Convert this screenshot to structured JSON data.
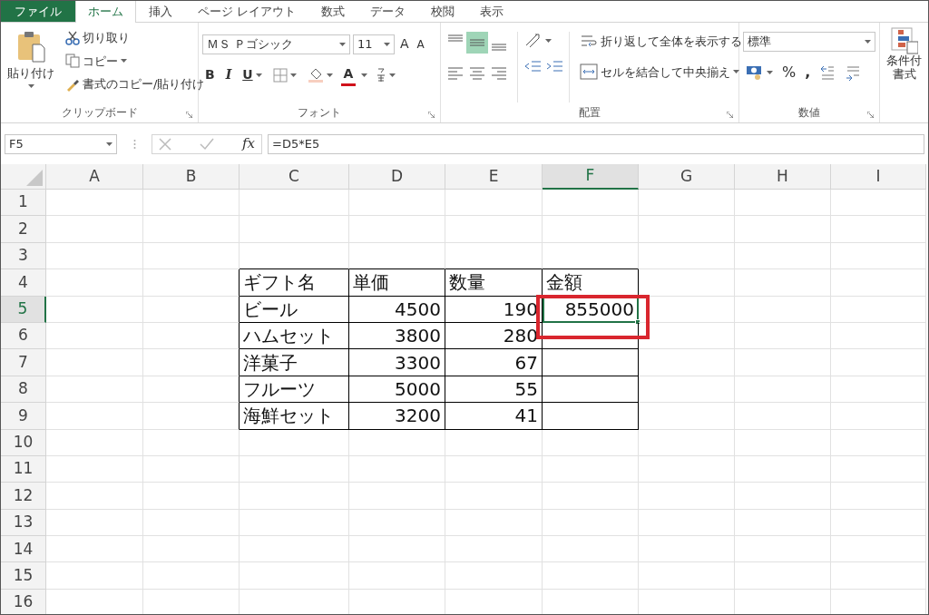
{
  "tabs": [
    {
      "label": "ファイル",
      "kind": "file",
      "selected": false
    },
    {
      "label": "ホーム",
      "kind": "tab",
      "selected": true
    },
    {
      "label": "挿入",
      "kind": "tab",
      "selected": false
    },
    {
      "label": "ページ レイアウト",
      "kind": "tab",
      "selected": false
    },
    {
      "label": "数式",
      "kind": "tab",
      "selected": false
    },
    {
      "label": "データ",
      "kind": "tab",
      "selected": false
    },
    {
      "label": "校閲",
      "kind": "tab",
      "selected": false
    },
    {
      "label": "表示",
      "kind": "tab",
      "selected": false
    }
  ],
  "clipboard": {
    "paste": "貼り付け",
    "cut": "切り取り",
    "copy": "コピー",
    "format_painter": "書式のコピー/貼り付け",
    "label": "クリップボード"
  },
  "font": {
    "name": "ＭＳ Ｐゴシック",
    "size": "11",
    "grow": "A",
    "shrink": "A",
    "bold": "B",
    "italic": "I",
    "underline": "U",
    "font_color": "A",
    "label": "フォント"
  },
  "alignment": {
    "align_buttons": [
      {
        "kind": "top",
        "selected": false
      },
      {
        "kind": "middle",
        "selected": true
      },
      {
        "kind": "bottom",
        "selected": false
      },
      {
        "kind": "left",
        "selected": false
      },
      {
        "kind": "center",
        "selected": false
      },
      {
        "kind": "right",
        "selected": false
      }
    ],
    "wrap_text": "折り返して全体を表示する",
    "merge_center": "セルを結合して中央揃え",
    "label": "配置"
  },
  "number": {
    "format": "標準",
    "percent": "%",
    "comma": ",",
    "label": "数値"
  },
  "styles": {
    "conditional_formatting": [
      "条件付",
      "書式"
    ]
  },
  "formula_bar": {
    "name_box": "F5",
    "function_label": "fx",
    "formula": "=D5*E5"
  },
  "sheet": {
    "columns": [
      {
        "label": "A",
        "selected": false
      },
      {
        "label": "B",
        "selected": false
      },
      {
        "label": "C",
        "selected": false
      },
      {
        "label": "D",
        "selected": false
      },
      {
        "label": "E",
        "selected": false
      },
      {
        "label": "F",
        "selected": true
      },
      {
        "label": "G",
        "selected": false
      },
      {
        "label": "H",
        "selected": false
      },
      {
        "label": "I",
        "selected": false
      }
    ],
    "rows": [
      {
        "label": "1",
        "selected": false
      },
      {
        "label": "2",
        "selected": false
      },
      {
        "label": "3",
        "selected": false
      },
      {
        "label": "4",
        "selected": false
      },
      {
        "label": "5",
        "selected": true
      },
      {
        "label": "6",
        "selected": false
      },
      {
        "label": "7",
        "selected": false
      },
      {
        "label": "8",
        "selected": false
      },
      {
        "label": "9",
        "selected": false
      },
      {
        "label": "10",
        "selected": false
      },
      {
        "label": "11",
        "selected": false
      },
      {
        "label": "12",
        "selected": false
      },
      {
        "label": "13",
        "selected": false
      },
      {
        "label": "14",
        "selected": false
      },
      {
        "label": "15",
        "selected": false
      },
      {
        "label": "16",
        "selected": false
      }
    ],
    "table": {
      "header": [
        "ギフト名",
        "単価",
        "数量",
        "金額"
      ],
      "rows": [
        {
          "name": "ビール",
          "price": "4500",
          "quantity": "190",
          "amount": "855000",
          "active": true
        },
        {
          "name": "ハムセット",
          "price": "3800",
          "quantity": "280",
          "active": false
        },
        {
          "name": "洋菓子",
          "price": "3300",
          "quantity": "67",
          "active": false
        },
        {
          "name": "フルーツ",
          "price": "5000",
          "quantity": "55",
          "active": false
        },
        {
          "name": "海鮮セット",
          "price": "3200",
          "quantity": "41",
          "active": false
        }
      ]
    },
    "highlight": true
  }
}
